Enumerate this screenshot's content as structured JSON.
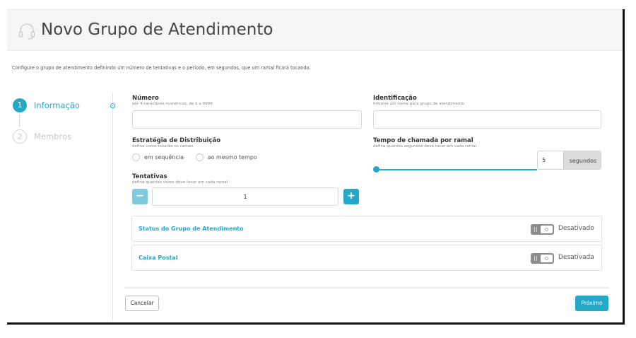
{
  "header": {
    "title": "Novo Grupo de Atendimento",
    "icon": "headset-icon"
  },
  "description": "Configure o grupo de atendimento definindo um número de tentativas e o período, em segundos, que um ramal ficará tocando.",
  "steps": [
    {
      "number": "1",
      "label": "Informação",
      "state": "active"
    },
    {
      "number": "2",
      "label": "Membros",
      "state": "inactive"
    }
  ],
  "form": {
    "numero": {
      "label": "Número",
      "hint": "até 4 caracteres numéricos, de 1 a 9999",
      "value": ""
    },
    "identificacao": {
      "label": "Identificação",
      "hint": "Informe um nome para grupo de atendimento",
      "value": ""
    },
    "estrategia": {
      "label": "Estratégia de Distribuição",
      "hint": "defina como tocarão os ramais",
      "options": [
        "em sequência",
        "ao mesmo tempo"
      ]
    },
    "tempo": {
      "label": "Tempo de chamada por ramal",
      "hint": "defina quantos segundos deve tocar em cada ramal",
      "value": "5",
      "unit": "segundos",
      "slider_fraction": 0.0
    },
    "tentativas": {
      "label": "Tentativas",
      "hint": "defina quantas vezes deve tocar em cada ramal",
      "value": "1",
      "minus": "−",
      "plus": "+"
    }
  },
  "cards": [
    {
      "title": "Status do Grupo de Atendimento",
      "state": "Desativado"
    },
    {
      "title": "Caixa Postal",
      "state": "Desativada"
    }
  ],
  "footer": {
    "cancel": "Cancelar",
    "next": "Próximo"
  },
  "colors": {
    "accent": "#25a7c8",
    "accent_light": "#7ecbdf",
    "toggle_off": "#8c8c8c"
  }
}
